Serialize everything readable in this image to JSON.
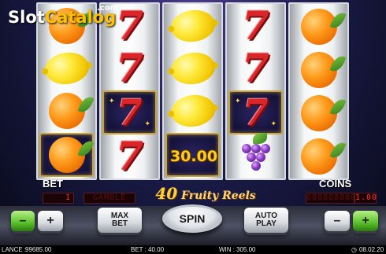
{
  "watermark": {
    "slot": "Slot",
    "catalog": "Catalog",
    "com": ".com"
  },
  "reels": [
    [
      "orange",
      "lemon",
      "orange",
      "framed-orange"
    ],
    [
      "seven",
      "seven",
      "framed-seven",
      "seven"
    ],
    [
      "lemon",
      "lemon",
      "lemon",
      "framed-blank"
    ],
    [
      "seven",
      "seven",
      "framed-seven",
      "grapes"
    ],
    [
      "orange",
      "orange",
      "orange",
      "orange"
    ]
  ],
  "win_display": "30.00",
  "labels": {
    "bet": "BET",
    "coins": "COINS"
  },
  "led": {
    "bet_value": "1",
    "gamble": "GAMBLE",
    "coins_dim": "888888888",
    "coins_value": "1.00"
  },
  "game_logo": {
    "number": "40",
    "name": "Fruity Reels"
  },
  "buttons": {
    "minus": "–",
    "plus": "+",
    "max_bet": "MAX\nBET",
    "spin": "SPIN",
    "auto_play": "AUTO\nPLAY"
  },
  "status_bar": {
    "balance_label": "LANCE :",
    "balance_value": "99685.00",
    "bet_label": "BET :",
    "bet_value": "40.00",
    "win_label": "WIN :",
    "win_value": "305.00",
    "clock": "08.02.20"
  }
}
